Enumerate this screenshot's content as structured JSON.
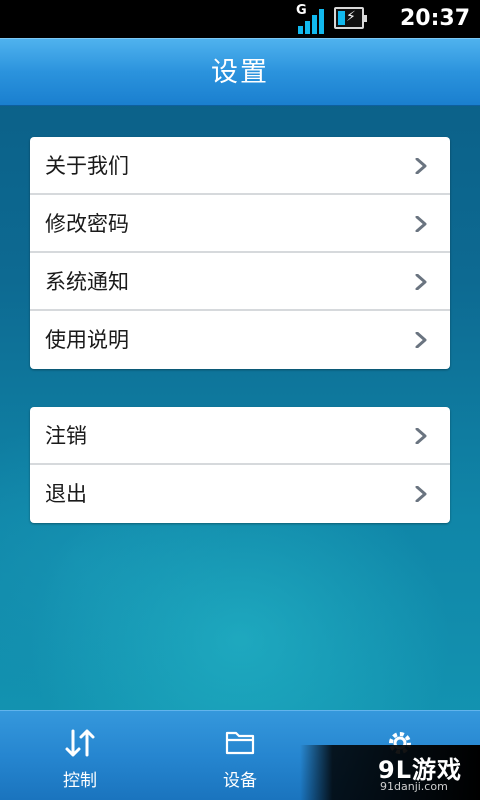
{
  "status_bar": {
    "network": "G",
    "time": "20:37"
  },
  "header": {
    "title": "设置"
  },
  "menu_groups": [
    {
      "items": [
        {
          "label": "关于我们",
          "icon": "chevron-right-icon"
        },
        {
          "label": "修改密码",
          "icon": "chevron-right-icon"
        },
        {
          "label": "系统通知",
          "icon": "chevron-right-icon"
        },
        {
          "label": "使用说明",
          "icon": "chevron-right-icon"
        }
      ]
    },
    {
      "items": [
        {
          "label": "注销",
          "icon": "chevron-right-icon"
        },
        {
          "label": "退出",
          "icon": "chevron-right-icon"
        }
      ]
    }
  ],
  "tabs": [
    {
      "label": "控制",
      "icon": "swap-vertical-arrows-icon"
    },
    {
      "label": "设备",
      "icon": "folder-icon"
    },
    {
      "label": "",
      "icon": "gear-icon"
    }
  ],
  "watermark": {
    "logo": "9L游戏",
    "url": "91danji.com"
  },
  "colors": {
    "title_bar": "#2b93dd",
    "tab_bar": "#2686d0",
    "background": "#0d6a92",
    "signal_accent": "#12b9ee"
  }
}
